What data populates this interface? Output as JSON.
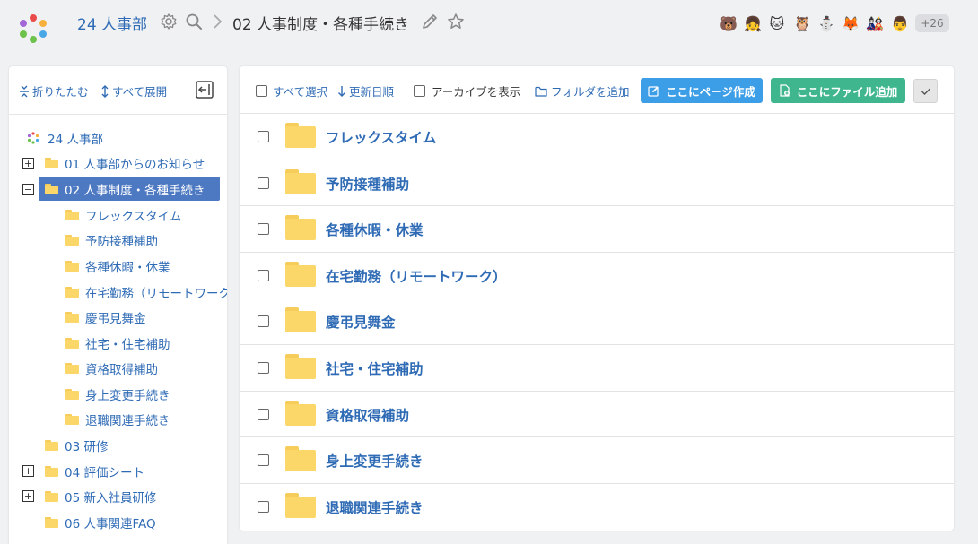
{
  "header": {
    "space_name": "24 人事部",
    "page_title": "02 人事制度・各種手続き",
    "more_members": "+26",
    "logo_colors": [
      "#e94b4b",
      "#f6b03c",
      "#4aa7e6",
      "#6cc24a",
      "#a266d8",
      "#f08bb5"
    ],
    "avatars": [
      "🐻",
      "👧",
      "🐱",
      "🦉",
      "⛄",
      "🦊",
      "🎎",
      "👨"
    ]
  },
  "sidebar": {
    "collapse_label": "折りたたむ",
    "expand_all_label": "すべて展開",
    "root": "24 人事部",
    "items": [
      {
        "label": "01 人事部からのお知らせ",
        "expander": "+"
      },
      {
        "label": "02 人事制度・各種手続き",
        "expander": "−",
        "selected": true
      },
      {
        "label": "フレックスタイム"
      },
      {
        "label": "予防接種補助"
      },
      {
        "label": "各種休暇・休業"
      },
      {
        "label": "在宅勤務（リモートワーク）"
      },
      {
        "label": "慶弔見舞金"
      },
      {
        "label": "社宅・住宅補助"
      },
      {
        "label": "資格取得補助"
      },
      {
        "label": "身上変更手続き"
      },
      {
        "label": "退職関連手続き"
      },
      {
        "label": "03 研修"
      },
      {
        "label": "04 評価シート",
        "expander": "+"
      },
      {
        "label": "05 新入社員研修",
        "expander": "+"
      },
      {
        "label": "06 人事関連FAQ"
      }
    ]
  },
  "toolbar": {
    "select_all": "すべて選択",
    "sort": "更新日順",
    "show_archive": "アーカイブを表示",
    "add_folder": "フォルダを追加",
    "create_page": "ここにページ作成",
    "add_file": "ここにファイル追加",
    "colors": {
      "page_button": "#3d9ee8",
      "file_button": "#3fb68e",
      "link": "#2f6bb5"
    }
  },
  "folders": [
    "フレックスタイム",
    "予防接種補助",
    "各種休暇・休業",
    "在宅勤務（リモートワーク）",
    "慶弔見舞金",
    "社宅・住宅補助",
    "資格取得補助",
    "身上変更手続き",
    "退職関連手続き"
  ]
}
